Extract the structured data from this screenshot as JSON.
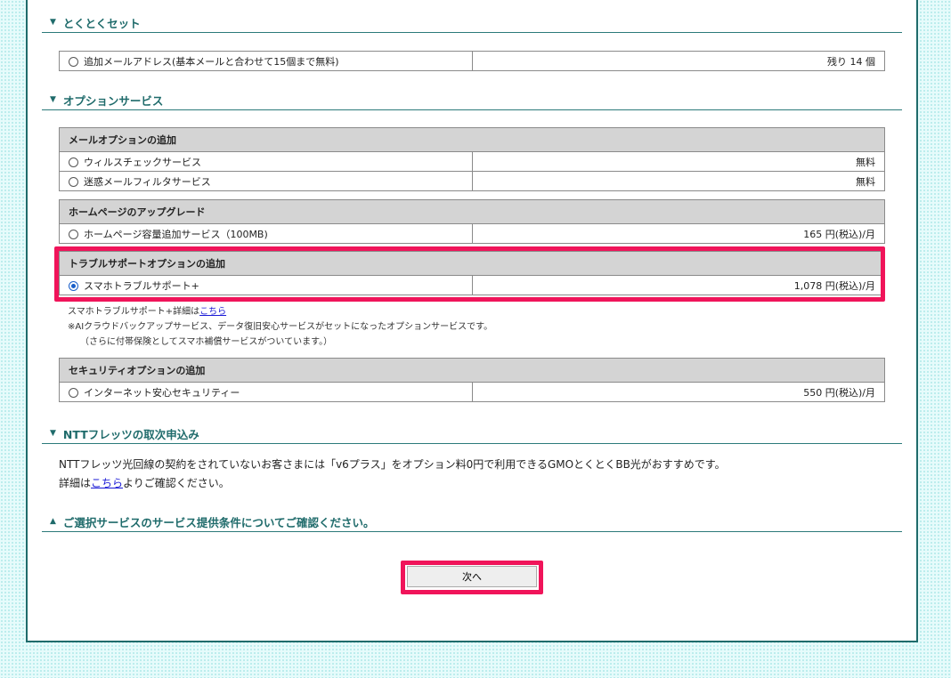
{
  "sections": {
    "tokutoku": {
      "title": "とくとくセット",
      "items": [
        {
          "label": "追加メールアドレス(基本メールと合わせて15個まで無料)",
          "value": "残り 14 個"
        }
      ]
    },
    "option": {
      "title": "オプションサービス",
      "groups": [
        {
          "title": "メールオプションの追加",
          "items": [
            {
              "label": "ウィルスチェックサービス",
              "value": "無料"
            },
            {
              "label": "迷惑メールフィルタサービス",
              "value": "無料"
            }
          ]
        },
        {
          "title": "ホームページのアップグレード",
          "items": [
            {
              "label": "ホームページ容量追加サービス（100MB)",
              "value": "165 円(税込)/月"
            }
          ]
        },
        {
          "title": "トラブルサポートオプションの追加",
          "items": [
            {
              "label": "スマホトラブルサポート+",
              "value": "1,078 円(税込)/月",
              "selected": true
            }
          ]
        },
        {
          "title": "セキュリティオプションの追加",
          "items": [
            {
              "label": "インターネット安心セキュリティー",
              "value": "550 円(税込)/月"
            }
          ]
        }
      ],
      "note": {
        "line1_prefix": "スマホトラブルサポート+詳細は",
        "line1_link": "こちら",
        "line2": "※AIクラウドバックアップサービス、データ復旧安心サービスがセットになったオプションサービスです。",
        "line3": "（さらに付帯保険としてスマホ補償サービスがついています。）"
      }
    },
    "ntt": {
      "title": "NTTフレッツの取次申込み",
      "text1": "NTTフレッツ光回線の契約をされていないお客さまには「v6プラス」をオプション料0円で利用できるGMOとくとくBB光がおすすめです。",
      "text2_prefix": "詳細は",
      "text2_link": "こちら",
      "text2_suffix": "よりご確認ください。"
    },
    "conditions": {
      "title": "ご選択サービスのサービス提供条件についてご確認ください。"
    }
  },
  "next_button": "次へ",
  "colors": {
    "accent": "#1f6b6b",
    "highlight": "#f0145a",
    "link": "#1a1ad6"
  },
  "icons": {
    "collapse": "triangle-down-icon",
    "expand": "triangle-up-icon",
    "radio": "radio-icon"
  }
}
